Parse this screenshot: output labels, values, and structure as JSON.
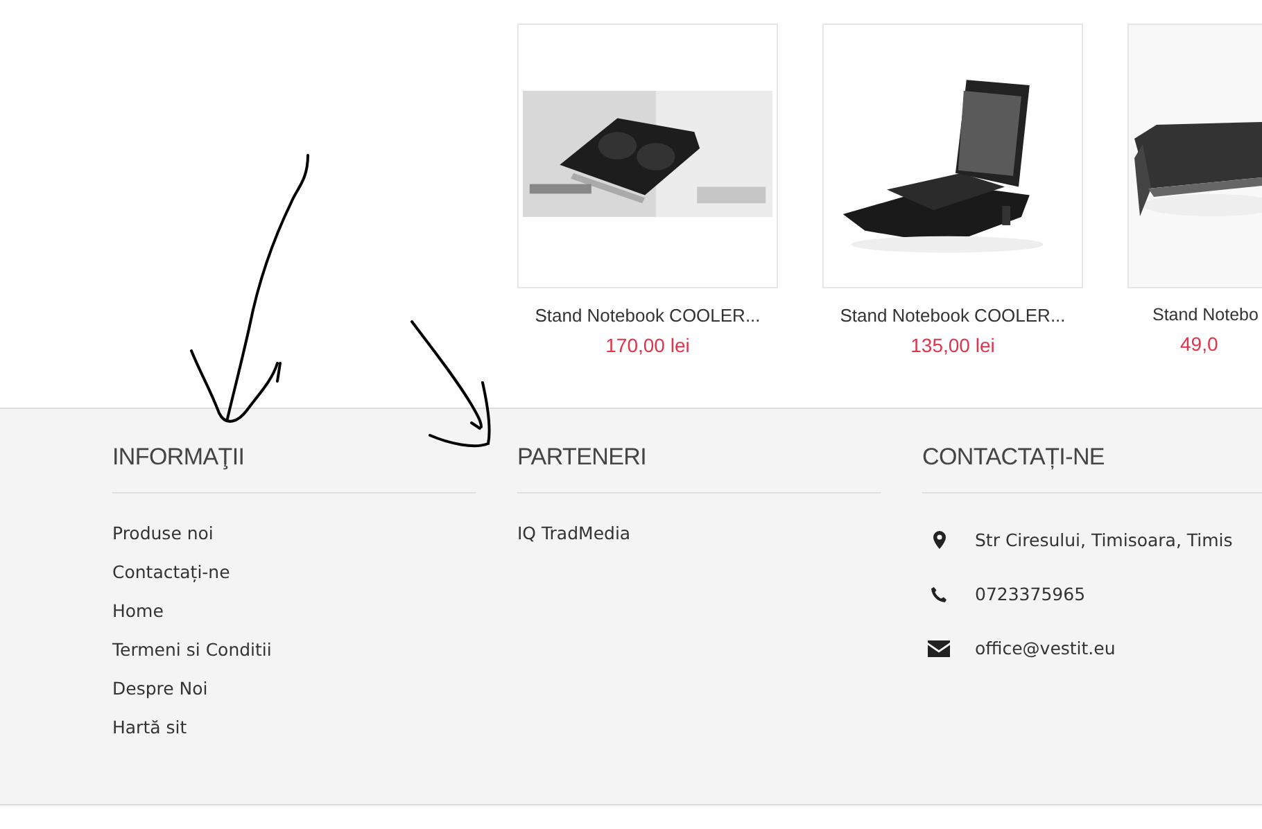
{
  "products": [
    {
      "title": "Stand Notebook COOLER...",
      "price": "170,00 lei"
    },
    {
      "title": "Stand Notebook COOLER...",
      "price": "135,00 lei"
    },
    {
      "title": "Stand Notebo",
      "price": "49,0"
    }
  ],
  "footer": {
    "columns": [
      {
        "kind": "links",
        "title": "INFORMAŢII",
        "links": [
          "Produse noi",
          "Contactați-ne",
          "Home",
          "Termeni si Conditii",
          "Despre Noi",
          "Hartă sit"
        ]
      },
      {
        "kind": "links",
        "title": "PARTENERI",
        "links": [
          "IQ TradMedia"
        ]
      },
      {
        "kind": "contact",
        "title": "CONTACTAȚI-NE",
        "items": [
          {
            "kind": "address",
            "text": "Str Ciresului, Timisoara, Timis"
          },
          {
            "kind": "phone",
            "text": "0723375965"
          },
          {
            "kind": "email",
            "text": "office@vestit.eu"
          }
        ]
      }
    ]
  }
}
